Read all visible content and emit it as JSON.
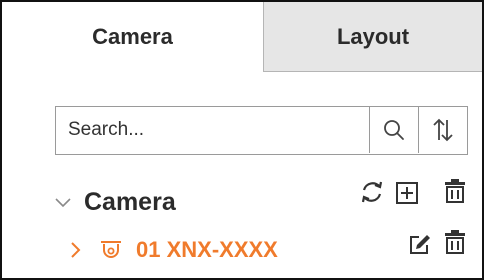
{
  "tabs": [
    {
      "label": "Camera",
      "active": true
    },
    {
      "label": "Layout",
      "active": false
    }
  ],
  "search": {
    "placeholder": "Search...",
    "search_icon": "search-icon",
    "sort_icon": "sort-icon"
  },
  "tree": {
    "group": {
      "label": "Camera",
      "expanded": true,
      "actions": [
        "refresh-icon",
        "add-icon",
        "delete-icon"
      ]
    },
    "items": [
      {
        "label": "01 XNX-XXXX",
        "icon": "camera-icon",
        "expanded": false,
        "actions": [
          "edit-icon",
          "delete-icon"
        ]
      }
    ]
  },
  "colors": {
    "accent": "#f07b2c",
    "text": "#2b2b2b",
    "inactive_tab_bg": "#e6e6e6",
    "border": "#9a9a9a"
  }
}
